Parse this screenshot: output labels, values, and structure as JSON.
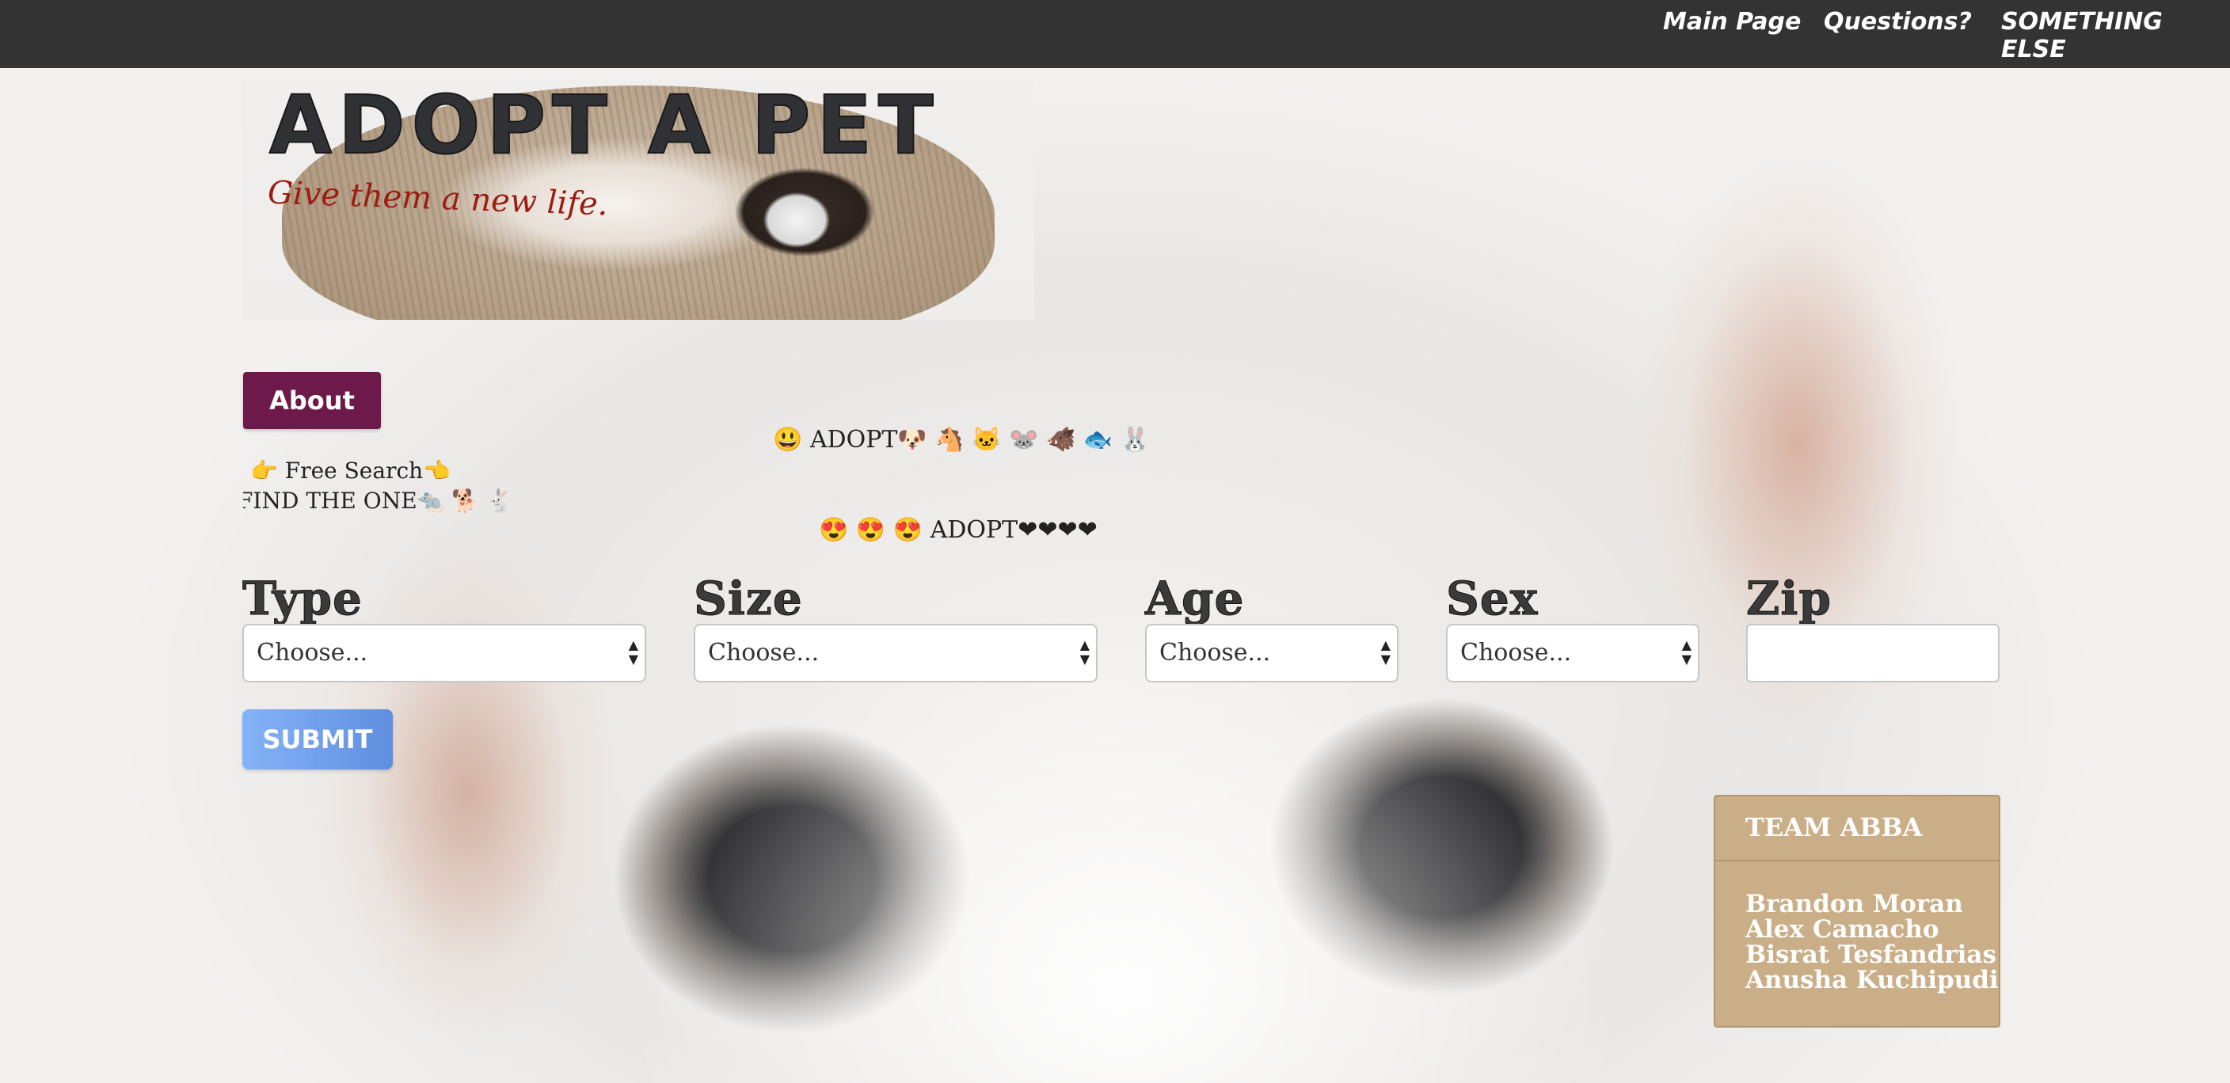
{
  "nav": {
    "links": [
      {
        "label": "Main Page"
      },
      {
        "label": "Questions?"
      },
      {
        "label": "SOMETHING ELSE"
      }
    ]
  },
  "banner": {
    "title": "ADOPT A PET",
    "tagline": "Give them a new life."
  },
  "about_button": "About",
  "side_text": {
    "free_search": "👉 Free Search👈",
    "find_one": "FIND THE ONE🐀 🐕 🐇"
  },
  "marquee": {
    "line1": "😃 ADOPT🐶 🐴 🐱 🐭 🐗 🐟 🐰",
    "line2": "😍 😍 😍 ADOPT❤❤❤❤"
  },
  "form": {
    "type": {
      "label": "Type",
      "value": "Choose..."
    },
    "size": {
      "label": "Size",
      "value": "Choose..."
    },
    "age": {
      "label": "Age",
      "value": "Choose..."
    },
    "sex": {
      "label": "Sex",
      "value": "Choose..."
    },
    "zip": {
      "label": "Zip",
      "value": ""
    },
    "submit": "SUBMIT"
  },
  "team": {
    "title": "TEAM ABBA",
    "members": [
      "Brandon Moran",
      "Alex Camacho",
      "Bisrat Tesfandrias",
      "Anusha Kuchipudi"
    ]
  }
}
